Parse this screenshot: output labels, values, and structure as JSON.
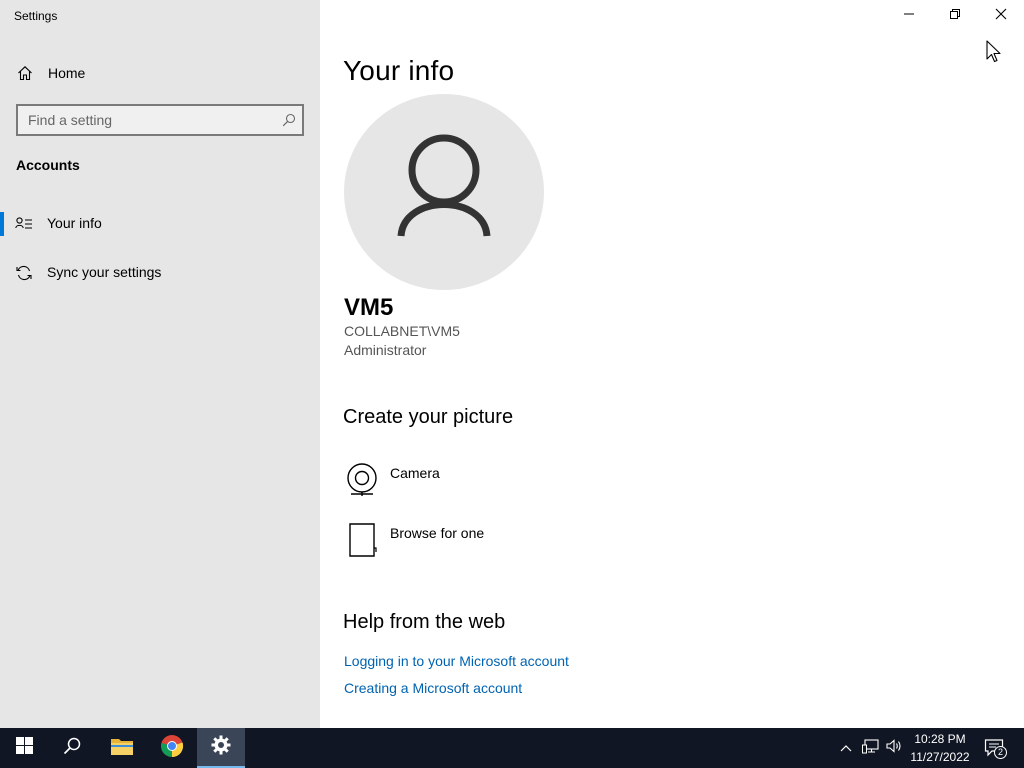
{
  "window": {
    "app_title": "Settings",
    "controls": {
      "minimize": "minimize-icon",
      "restore": "restore-icon",
      "close": "close-icon"
    }
  },
  "sidebar": {
    "home_label": "Home",
    "search_placeholder": "Find a setting",
    "section": "Accounts",
    "items": [
      {
        "label": "Your info",
        "icon": "user-list-icon",
        "selected": true
      },
      {
        "label": "Sync your settings",
        "icon": "sync-icon",
        "selected": false
      }
    ]
  },
  "main": {
    "title": "Your info",
    "user": {
      "name": "VM5",
      "account": "COLLABNET\\VM5",
      "role": "Administrator"
    },
    "create_picture": {
      "heading": "Create your picture",
      "options": [
        {
          "label": "Camera",
          "icon": "webcam-icon"
        },
        {
          "label": "Browse for one",
          "icon": "document-icon"
        }
      ]
    },
    "help": {
      "heading": "Help from the web",
      "links": [
        "Logging in to your Microsoft account",
        "Creating a Microsoft account"
      ]
    }
  },
  "taskbar": {
    "apps": [
      "start-icon",
      "search-icon",
      "file-explorer-icon",
      "chrome-icon",
      "settings-icon"
    ],
    "active_app": "settings-icon",
    "clock": {
      "time": "10:28 PM",
      "date": "11/27/2022"
    },
    "notification_count": "2"
  },
  "colors": {
    "accent": "#0078d7",
    "link": "#0063b1",
    "sidebar_bg": "#e6e6e6",
    "taskbar_bg": "#101623"
  }
}
